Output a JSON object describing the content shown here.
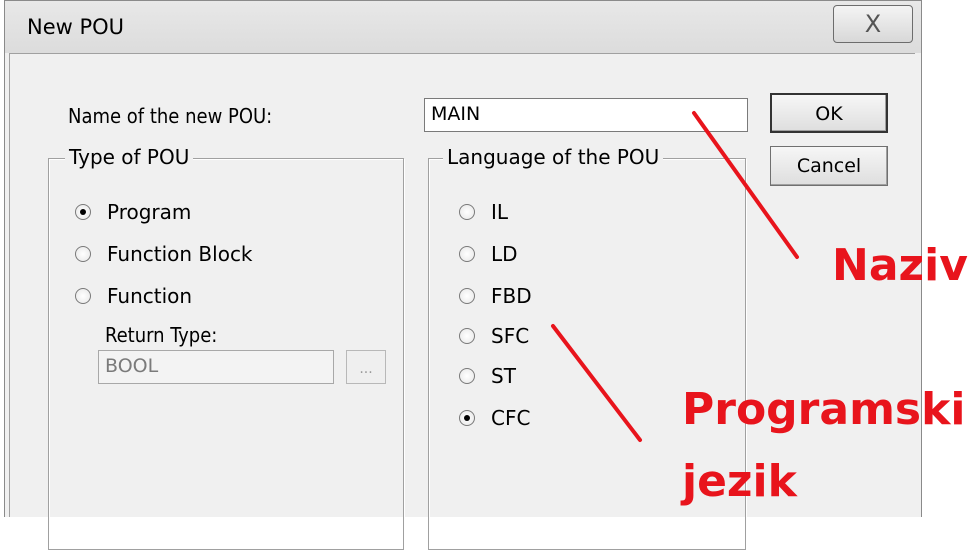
{
  "window": {
    "title": "New POU",
    "close_glyph": "X"
  },
  "name_field": {
    "label": "Name of the new POU:",
    "value": "MAIN"
  },
  "buttons": {
    "ok": "OK",
    "cancel": "Cancel"
  },
  "type_group": {
    "title": "Type of POU",
    "options": [
      {
        "label": "Program",
        "checked": true
      },
      {
        "label": "Function Block",
        "checked": false
      },
      {
        "label": "Function",
        "checked": false
      }
    ],
    "return_type_label": "Return Type:",
    "return_type_value": "BOOL",
    "browse_label": "..."
  },
  "language_group": {
    "title": "Language of the POU",
    "options": [
      {
        "label": "IL",
        "checked": false
      },
      {
        "label": "LD",
        "checked": false
      },
      {
        "label": "FBD",
        "checked": false
      },
      {
        "label": "SFC",
        "checked": false
      },
      {
        "label": "ST",
        "checked": false
      },
      {
        "label": "CFC",
        "checked": true
      }
    ]
  },
  "annotations": {
    "naziv": "Naziv",
    "programski": "Programski",
    "jezik": "jezik"
  },
  "colors": {
    "annotation": "#e8141c",
    "dialog_bg": "#f0f0f0"
  }
}
